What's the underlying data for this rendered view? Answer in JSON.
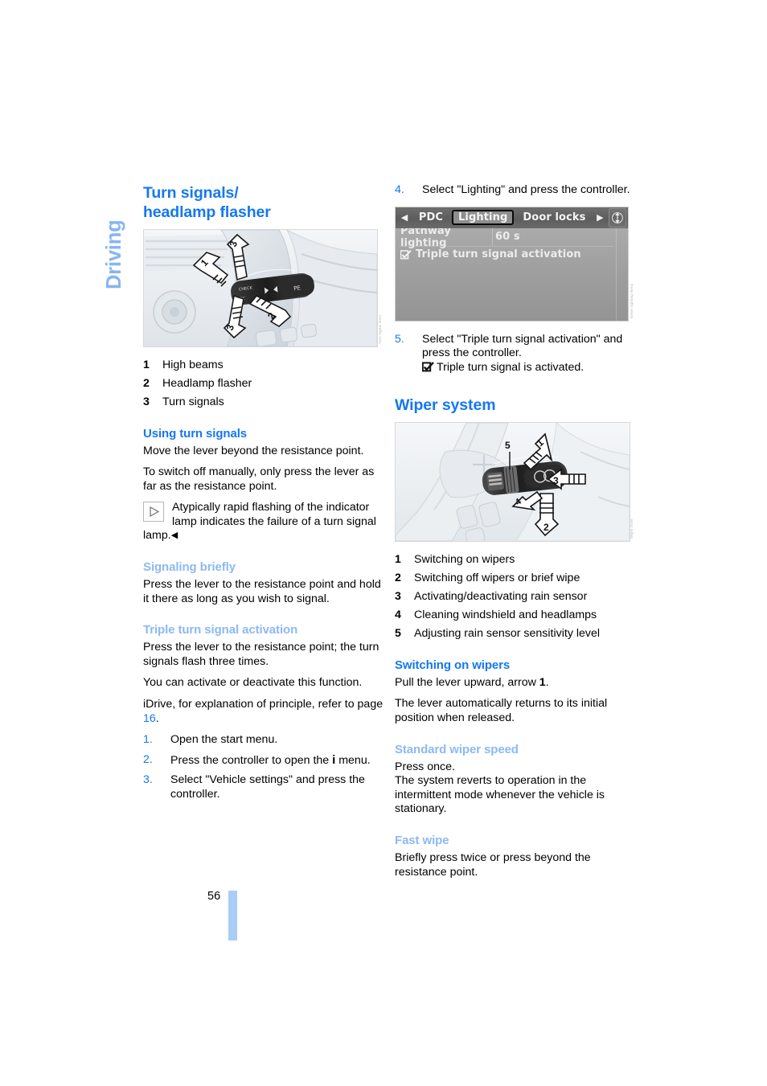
{
  "chapter_tab": {
    "label": "Driving"
  },
  "folio": {
    "page_number": "56"
  },
  "left_column": {
    "section_title_line1": "Turn signals/",
    "section_title_line2": "headlamp flasher",
    "figure": {
      "credit": "Turn signal lever"
    },
    "legend": [
      {
        "num": "1",
        "text": "High beams"
      },
      {
        "num": "2",
        "text": "Headlamp flasher"
      },
      {
        "num": "3",
        "text": "Turn signals"
      }
    ],
    "using_turn_signals": {
      "heading": "Using turn signals",
      "p1": "Move the lever beyond the resistance point.",
      "p2": "To switch off manually, only press the lever as far as the resistance point.",
      "note_text": "Atypically rapid flashing of the indicator lamp indicates the failure of a turn signal",
      "note_tail": "lamp.",
      "note_end_mark": "◀"
    },
    "signaling_briefly": {
      "heading": "Signaling briefly",
      "p1": "Press the lever to the resistance point and hold it there as long as you wish to signal."
    },
    "triple_turn_signal": {
      "heading": "Triple turn signal activation",
      "p1": "Press the lever to the resistance point; the turn signals flash three times.",
      "p2": "You can activate or deactivate this function.",
      "p3_before": "iDrive, for explanation of principle, refer to page ",
      "p3_link": "16",
      "p3_after": ".",
      "steps": [
        {
          "num": "1.",
          "text": "Open the start menu."
        },
        {
          "num": "2.",
          "text_before": "Press the controller to open the ",
          "glyph": "i",
          "text_after": " menu."
        },
        {
          "num": "3.",
          "text": "Select \"Vehicle settings\" and press the controller."
        }
      ]
    }
  },
  "right_column": {
    "step4": {
      "num": "4.",
      "text": "Select \"Lighting\" and press the controller."
    },
    "idrive_screen": {
      "left_arrow": "◀",
      "right_arrow": "▶",
      "tabs": [
        {
          "label": "PDC",
          "selected": false
        },
        {
          "label": "Lighting",
          "selected": true
        },
        {
          "label": "Door locks",
          "selected": false
        }
      ],
      "rows": [
        {
          "label": "Pathway lighting",
          "value": "60 s",
          "checkbox": false
        },
        {
          "label": "Triple turn signal activation",
          "value": "",
          "checkbox": true
        }
      ],
      "credit": "iDrive lighting menu"
    },
    "step5": {
      "num": "5.",
      "line1": "Select \"Triple turn signal activation\" and",
      "line2": "press the controller.",
      "result": "Triple turn signal is activated."
    },
    "wiper_section": {
      "heading": "Wiper system",
      "figure": {
        "credit": "Wiper lever"
      },
      "legend": [
        {
          "num": "1",
          "text": "Switching on wipers"
        },
        {
          "num": "2",
          "text": "Switching off wipers or brief wipe"
        },
        {
          "num": "3",
          "text": "Activating/deactivating rain sensor"
        },
        {
          "num": "4",
          "text": "Cleaning windshield and headlamps"
        },
        {
          "num": "5",
          "text": "Adjusting rain sensor sensitivity level"
        }
      ],
      "switching_on": {
        "heading": "Switching on wipers",
        "p1_before": "Pull the lever upward, arrow ",
        "p1_bold": "1",
        "p1_after": ".",
        "p2": "The lever automatically returns to its initial position when released."
      },
      "standard_speed": {
        "heading": "Standard wiper speed",
        "p1": "Press once.",
        "p2": "The system reverts to operation in the intermittent mode whenever the vehicle is stationary."
      },
      "fast_wipe": {
        "heading": "Fast wipe",
        "p1": "Briefly press twice or press beyond the resistance point."
      }
    }
  },
  "colors": {
    "accent_blue": "#1478f0",
    "light_blue": "#8cb9f5",
    "tab_blue": "#85b6f2",
    "folio_bar": "#aacdf5"
  }
}
